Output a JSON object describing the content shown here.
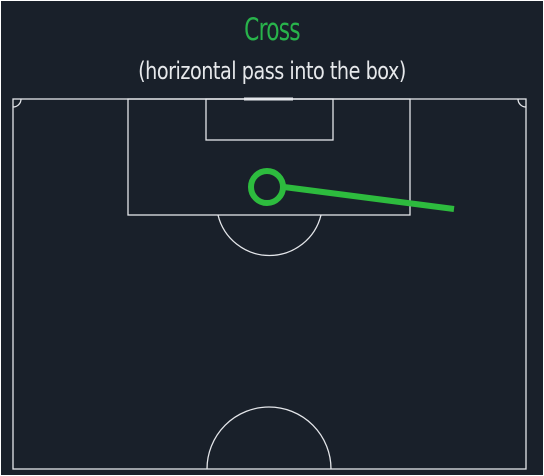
{
  "figure": {
    "title": "Cross",
    "subtitle": "(horizontal pass into the box)"
  },
  "colors": {
    "background": "#19202a",
    "pitch_lines": "#e4e6ea",
    "title": "#28b34b",
    "subtitle": "#e6e8eb",
    "pass_line": "#2dbb3e"
  },
  "pass": {
    "type": "cross",
    "direction": "horizontal",
    "target": "box"
  }
}
